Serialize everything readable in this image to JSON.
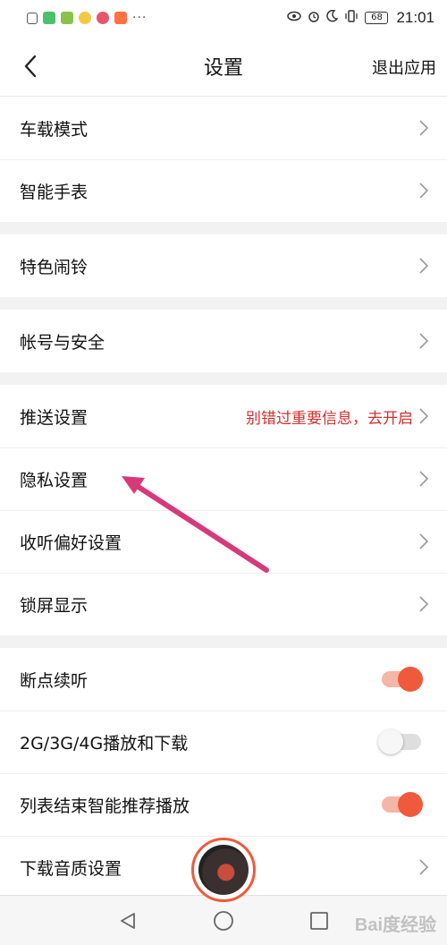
{
  "status_bar": {
    "time": "21:01",
    "battery": "68",
    "notification_icons": [
      "message-icon",
      "wechat-icon",
      "app-icon",
      "game-icon",
      "red-circle-icon",
      "scan-icon"
    ],
    "more": "···"
  },
  "header": {
    "title": "设置",
    "exit_label": "退出应用"
  },
  "settings": {
    "car_mode": "车载模式",
    "smartwatch": "智能手表",
    "alarm": "特色闹铃",
    "account_security": "帐号与安全",
    "push": "推送设置",
    "push_hint": "别错过重要信息，去开启",
    "privacy": "隐私设置",
    "listening_pref": "收听偏好设置",
    "lock_screen": "锁屏显示",
    "resume": "断点续听",
    "mobile_data": "2G/3G/4G播放和下载",
    "smart_recommend": "列表结束智能推荐播放",
    "download_quality": "下载音质设置"
  },
  "toggles": {
    "resume": true,
    "mobile_data": false,
    "smart_recommend": true
  },
  "colors": {
    "accent": "#ef5a3c",
    "hint": "#d32f2f",
    "annotation_arrow": "#d63a7a"
  },
  "watermark": "Bai度经验"
}
